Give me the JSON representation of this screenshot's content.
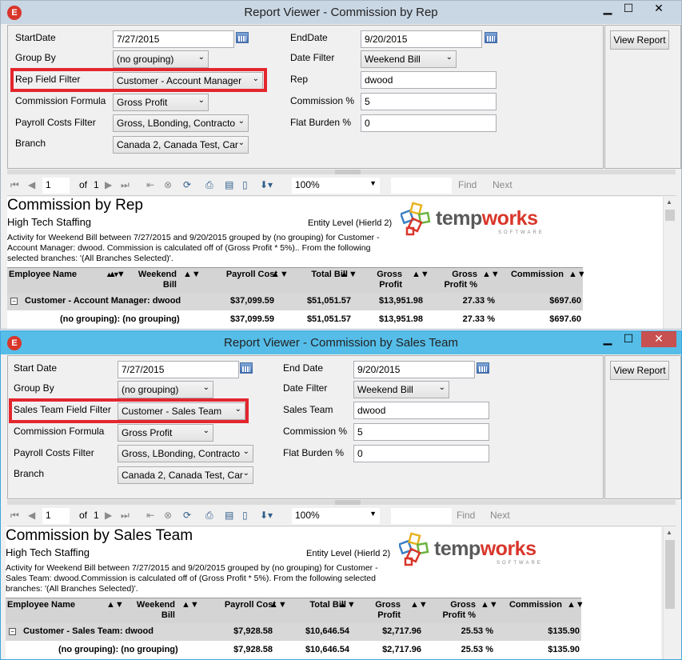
{
  "windows": [
    {
      "title": "Report Viewer - Commission by Rep",
      "app_icon": "E",
      "params": {
        "start_date_label": "StartDate",
        "start_date": "7/27/2015",
        "end_date_label": "EndDate",
        "end_date": "9/20/2015",
        "group_by_label": "Group By",
        "group_by": "(no grouping)",
        "date_filter_label": "Date Filter",
        "date_filter": "Weekend Bill",
        "field_filter_label": "Rep Field Filter",
        "field_filter": "Customer - Account Manager",
        "entity_label": "Rep",
        "entity_value": "dwood",
        "formula_label": "Commission Formula",
        "formula": "Gross Profit",
        "pct_label": "Commission %",
        "pct": "5",
        "payroll_label": "Payroll Costs Filter",
        "payroll": "Gross, LBonding, Contracto",
        "burden_label": "Flat Burden %",
        "burden": "0",
        "branch_label": "Branch",
        "branch": "Canada 2, Canada Test, Car"
      },
      "view_report": "View Report",
      "toolbar": {
        "page": "1",
        "of": "of",
        "total": "1",
        "zoom": "100%",
        "find": "Find",
        "next": "Next"
      },
      "report": {
        "title": "Commission by Rep",
        "company": "High Tech Staffing",
        "entity_level": "Entity Level (Hierld 2)",
        "description": "Activity for Weekend Bill between 7/27/2015 and 9/20/2015 grouped by (no grouping) for Customer - Account Manager: dwood. Commission is calculated off of (Gross Profit * 5%).. From the following selected branches: '(All Branches Selected)'.",
        "columns": [
          "Employee Name",
          "Weekend Bill",
          "Payroll Cost",
          "Total Bill",
          "Gross Profit",
          "Gross Profit %",
          "Commission"
        ],
        "group_row": {
          "label": "Customer - Account Manager: dwood",
          "payroll": "$37,099.59",
          "total_bill": "$51,051.57",
          "gross_profit": "$13,951.98",
          "gp_pct": "27.33 %",
          "commission": "$697.60"
        },
        "sub_row": {
          "label": "(no grouping): (no grouping)",
          "payroll": "$37,099.59",
          "total_bill": "$51,051.57",
          "gross_profit": "$13,951.98",
          "gp_pct": "27.33 %",
          "commission": "$697.60"
        }
      }
    },
    {
      "title": "Report Viewer - Commission by Sales Team",
      "app_icon": "E",
      "params": {
        "start_date_label": "Start Date",
        "start_date": "7/27/2015",
        "end_date_label": "End Date",
        "end_date": "9/20/2015",
        "group_by_label": "Group By",
        "group_by": "(no grouping)",
        "date_filter_label": "Date Filter",
        "date_filter": "Weekend Bill",
        "field_filter_label": "Sales Team Field Filter",
        "field_filter": "Customer - Sales Team",
        "entity_label": "Sales Team",
        "entity_value": "dwood",
        "formula_label": "Commission Formula",
        "formula": "Gross Profit",
        "pct_label": "Commission %",
        "pct": "5",
        "payroll_label": "Payroll Costs Filter",
        "payroll": "Gross, LBonding, Contracto",
        "burden_label": "Flat Burden %",
        "burden": "0",
        "branch_label": "Branch",
        "branch": "Canada 2, Canada Test, Car"
      },
      "view_report": "View Report",
      "toolbar": {
        "page": "1",
        "of": "of",
        "total": "1",
        "zoom": "100%",
        "find": "Find",
        "next": "Next"
      },
      "report": {
        "title": "Commission by Sales Team",
        "company": "High Tech Staffing",
        "entity_level": "Entity Level (Hierld 2)",
        "description": "Activity for Weekend Bill between 7/27/2015 and 9/20/2015 grouped by (no grouping) for Customer - Sales Team: dwood.Commission is calculated off of (Gross Profit * 5%). From the following selected branches: '(All Branches Selected)'.",
        "columns": [
          "Employee Name",
          "Weekend Bill",
          "Payroll Cost",
          "Total Bill",
          "Gross Profit",
          "Gross Profit %",
          "Commission"
        ],
        "group_row": {
          "label": "Customer - Sales Team: dwood",
          "payroll": "$7,928.58",
          "total_bill": "$10,646.54",
          "gross_profit": "$2,717.96",
          "gp_pct": "25.53 %",
          "commission": "$135.90"
        },
        "sub_row": {
          "label": "(no grouping): (no grouping)",
          "payroll": "$7,928.58",
          "total_bill": "$10,646.54",
          "gross_profit": "$2,717.96",
          "gp_pct": "25.53 %",
          "commission": "$135.90"
        }
      }
    }
  ],
  "logo": {
    "brand_a": "temp",
    "brand_b": "works",
    "tagline": "SOFTWARE"
  },
  "colors": {
    "highlight": "#e3262e",
    "win1_title": "#c9d6e3",
    "win2_title": "#55bde8"
  }
}
